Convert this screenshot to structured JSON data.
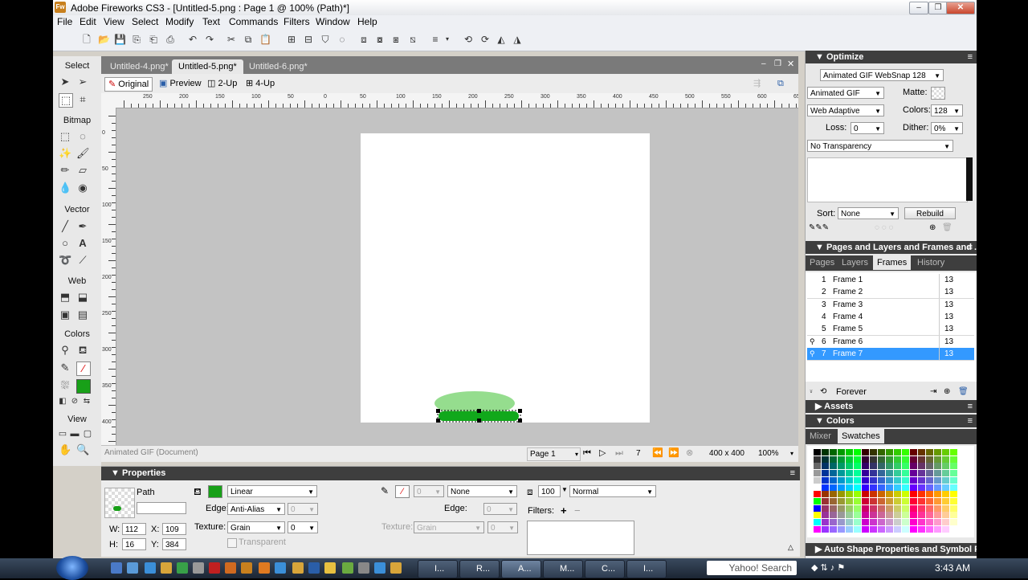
{
  "window": {
    "title": "Adobe Fireworks CS3 - [Untitled-5.png : Page 1 @ 100% (Path)*]",
    "logo": "Fw"
  },
  "menu": [
    "File",
    "Edit",
    "View",
    "Select",
    "Modify",
    "Text",
    "Commands",
    "Filters",
    "Window",
    "Help"
  ],
  "tools": {
    "sections": [
      "Select",
      "Bitmap",
      "Vector",
      "Web",
      "Colors",
      "View"
    ],
    "fill_color": "#18a018"
  },
  "document": {
    "tabs": [
      "Untitled-4.png*",
      "Untitled-5.png*",
      "Untitled-6.png*"
    ],
    "view_modes": [
      "Original",
      "Preview",
      "2-Up",
      "4-Up"
    ],
    "ruler_h": [
      "250",
      "200",
      "150",
      "100",
      "50",
      "0",
      "50",
      "100",
      "150",
      "200",
      "250",
      "300",
      "350",
      "400",
      "450",
      "500",
      "550",
      "600",
      "650"
    ],
    "ruler_v": [
      "0",
      "50",
      "100",
      "150",
      "200",
      "250",
      "300",
      "350",
      "400"
    ],
    "status": {
      "doc_type": "Animated GIF (Document)",
      "page": "Page 1",
      "frame": "7",
      "size": "400 x 400",
      "zoom": "100%"
    }
  },
  "properties": {
    "title": "Properties",
    "object_type": "Path",
    "w_label": "W:",
    "w": "112",
    "h_label": "H:",
    "h": "16",
    "x_label": "X:",
    "x": "109",
    "y_label": "Y:",
    "y": "384",
    "fill_type": "Linear",
    "edge_label": "Edge:",
    "edge": "Anti-Alias",
    "edge_amount": "0",
    "texture_label": "Texture:",
    "texture": "Grain",
    "texture_amount": "0",
    "transparent": "Transparent",
    "stroke_size": "0",
    "stroke_type": "None",
    "stroke_edge_label": "Edge:",
    "stroke_edge": "0",
    "stroke_texture_label": "Texture:",
    "stroke_texture": "Grain",
    "stroke_texture_amount": "0",
    "opacity": "100",
    "blend": "Normal",
    "filters_label": "Filters:"
  },
  "optimize": {
    "title": "Optimize",
    "preset": "Animated GIF WebSnap 128",
    "format": "Animated GIF",
    "matte_label": "Matte:",
    "palette": "Web Adaptive",
    "colors_label": "Colors:",
    "colors": "128",
    "loss_label": "Loss:",
    "loss": "0",
    "dither_label": "Dither:",
    "dither": "0%",
    "transparency": "No Transparency",
    "sort_label": "Sort:",
    "sort": "None",
    "rebuild": "Rebuild"
  },
  "pages_panel": {
    "title": "Pages and Layers and Frames and ...",
    "tabs": [
      "Pages",
      "Layers",
      "Frames",
      "History"
    ],
    "frames": [
      {
        "num": "1",
        "name": "Frame 1",
        "delay": "13"
      },
      {
        "num": "2",
        "name": "Frame 2",
        "delay": "13"
      },
      {
        "num": "3",
        "name": "Frame 3",
        "delay": "13"
      },
      {
        "num": "4",
        "name": "Frame 4",
        "delay": "13"
      },
      {
        "num": "5",
        "name": "Frame 5",
        "delay": "13"
      },
      {
        "num": "6",
        "name": "Frame 6",
        "delay": "13"
      },
      {
        "num": "7",
        "name": "Frame 7",
        "delay": "13"
      }
    ],
    "loop": "Forever"
  },
  "assets": {
    "title": "Assets"
  },
  "colors_panel": {
    "title": "Colors",
    "tabs": [
      "Mixer",
      "Swatches"
    ]
  },
  "auto_shape": {
    "title": "Auto Shape Properties and Symbol Pro..."
  },
  "taskbar": {
    "buttons": [
      "I...",
      "R...",
      "A...",
      "M...",
      "C...",
      "I..."
    ],
    "search": "Yahoo! Search",
    "time": "3:43 AM"
  }
}
